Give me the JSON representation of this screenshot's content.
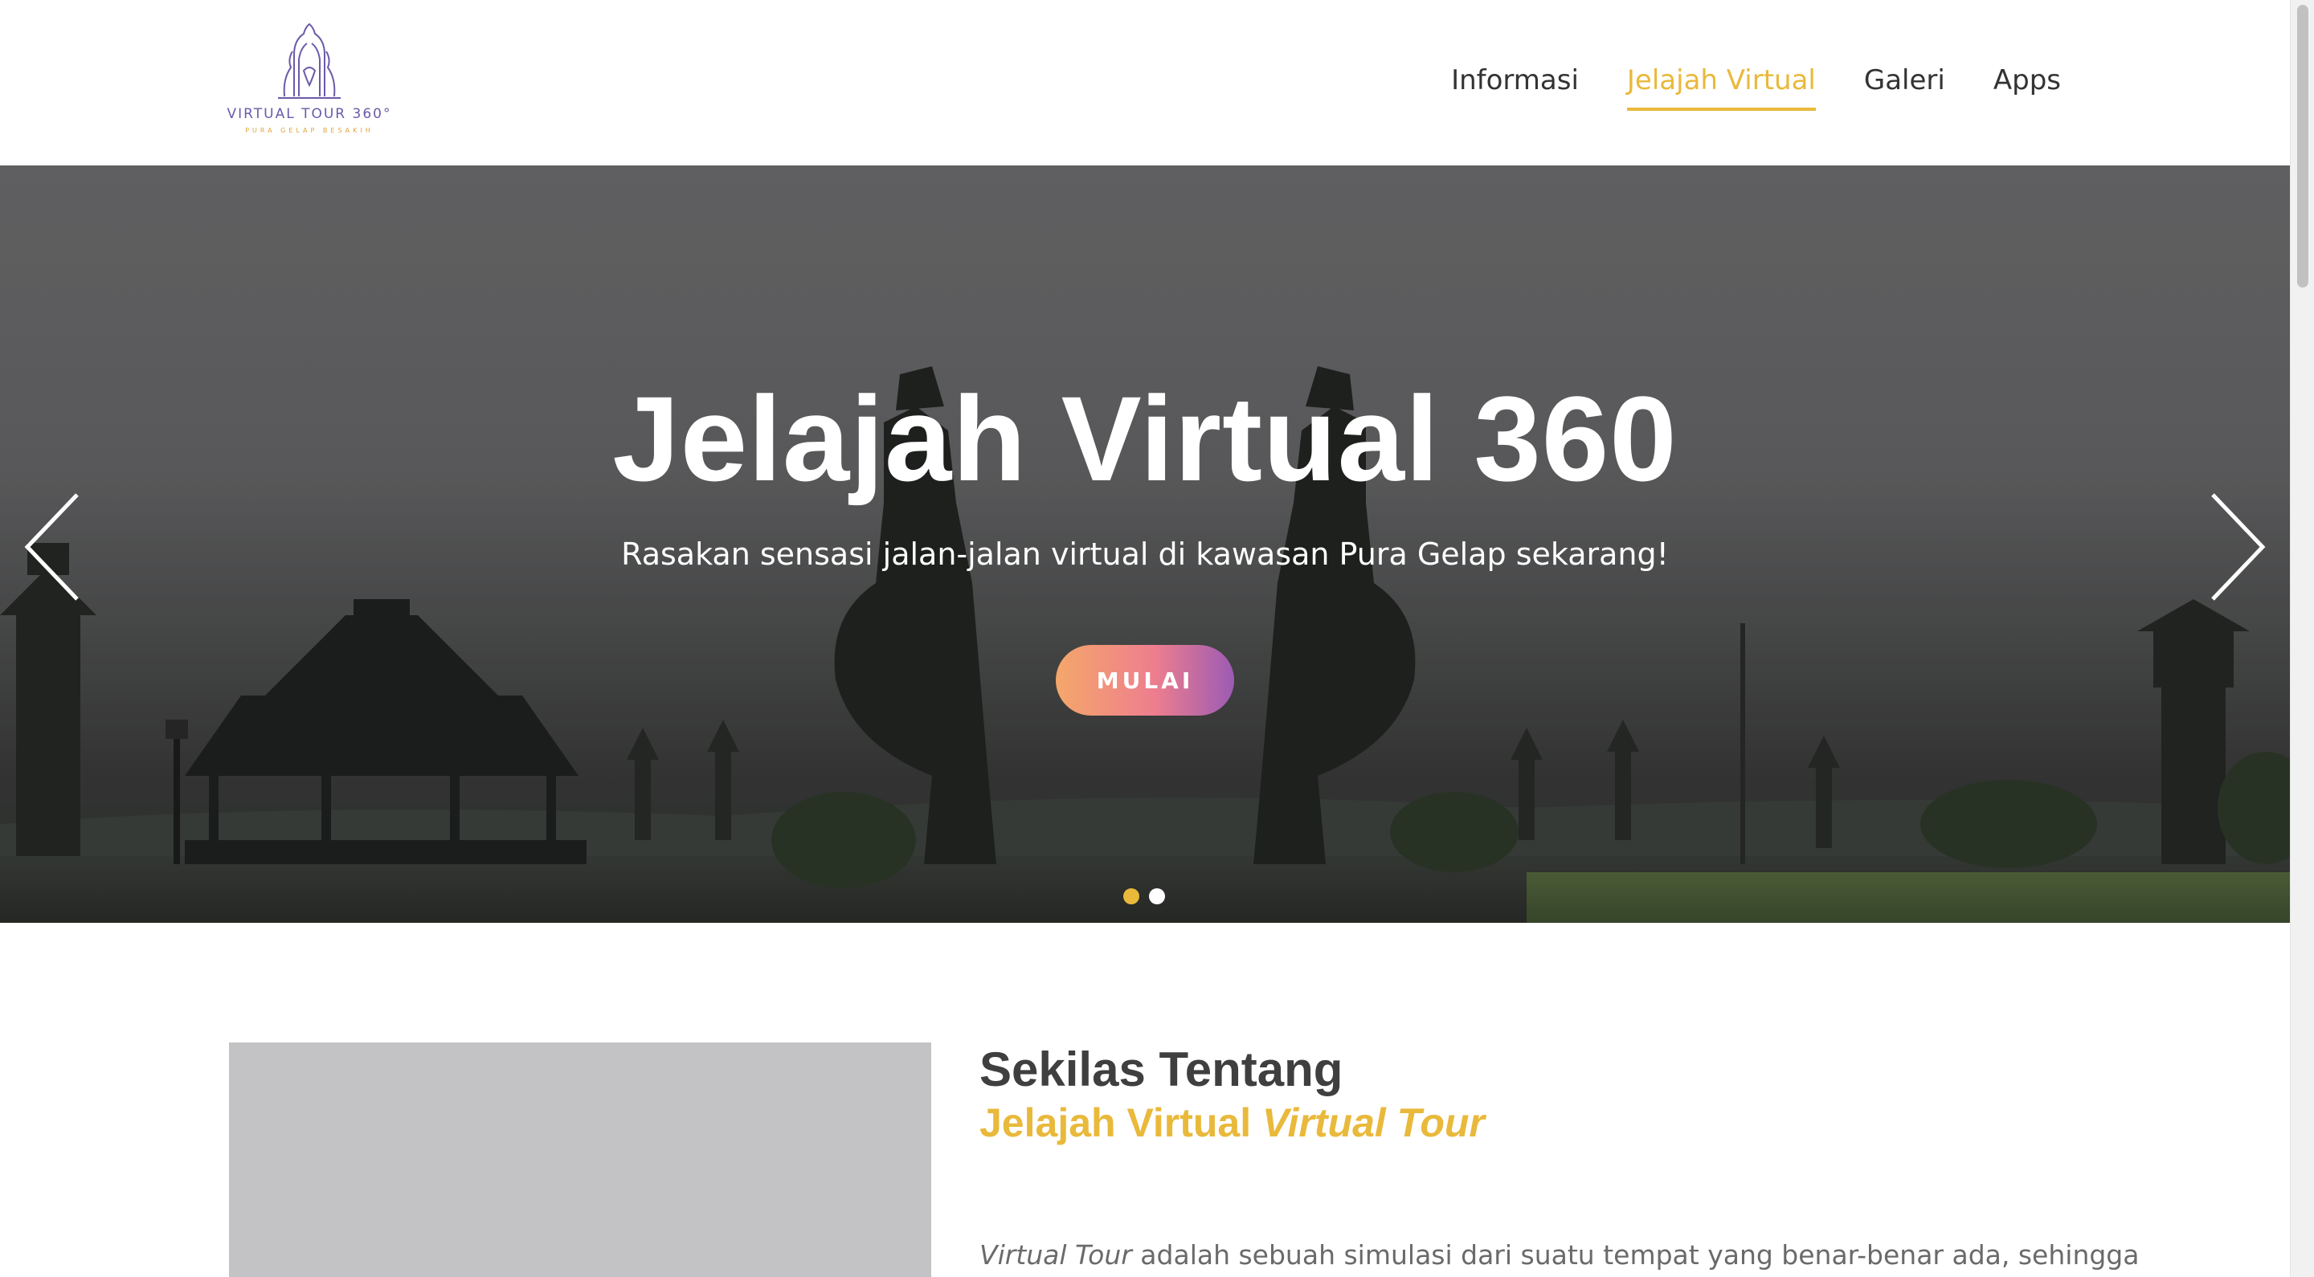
{
  "logo": {
    "title": "VIRTUAL TOUR 360°",
    "subtitle": "PURA GELAP BESAKIH"
  },
  "nav": {
    "items": [
      {
        "label": "Informasi",
        "active": false
      },
      {
        "label": "Jelajah Virtual",
        "active": true
      },
      {
        "label": "Galeri",
        "active": false
      },
      {
        "label": "Apps",
        "active": false
      }
    ]
  },
  "hero": {
    "title": "Jelajah Virtual 360",
    "subtitle": "Rasakan sensasi jalan-jalan virtual di kawasan Pura Gelap sekarang!",
    "button_label": "MULAI",
    "slides_total": 2,
    "active_slide": 1
  },
  "about": {
    "title": "Sekilas Tentang",
    "subtitle_plain": "Jelajah Virtual ",
    "subtitle_italic": "Virtual Tour",
    "text_italic": "Virtual Tour",
    "text_rest": " adalah sebuah simulasi dari suatu tempat yang benar-benar ada, sehingga"
  },
  "colors": {
    "accent": "#e9b93b",
    "button_gradient_start": "#f4a76a",
    "button_gradient_end": "#9c5bb4",
    "logo_purple": "#6b5aa8",
    "image_placeholder": "#c3c3c5"
  }
}
